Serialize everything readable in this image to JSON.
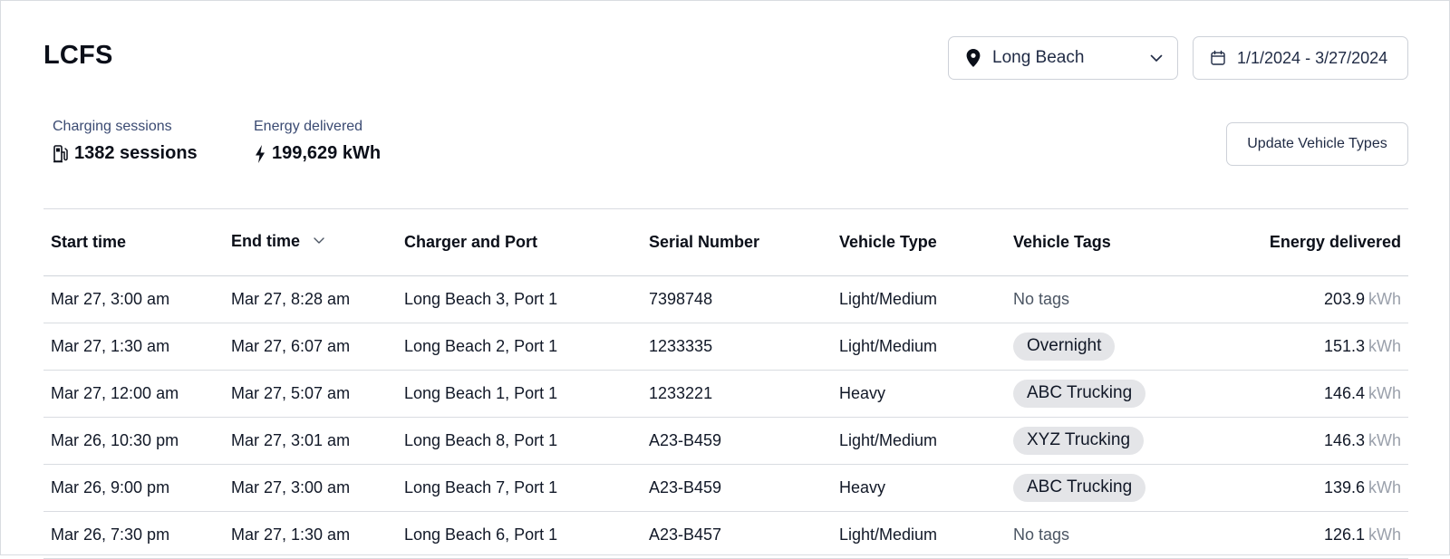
{
  "header": {
    "title": "LCFS",
    "location_value": "Long Beach",
    "date_range": "1/1/2024 - 3/27/2024"
  },
  "stats": {
    "sessions_label": "Charging sessions",
    "sessions_value": "1382 sessions",
    "energy_label": "Energy delivered",
    "energy_value": "199,629 kWh"
  },
  "actions": {
    "update_vehicle_types": "Update Vehicle Types"
  },
  "table": {
    "columns": [
      "Start time",
      "End time",
      "Charger and Port",
      "Serial Number",
      "Vehicle Type",
      "Vehicle Tags",
      "Energy delivered"
    ],
    "sort_column": "End time",
    "unit": "kWh",
    "rows": [
      {
        "start": "Mar 27, 3:00 am",
        "end": "Mar 27, 8:28 am",
        "charger": "Long Beach 3, Port 1",
        "serial": "7398748",
        "vehicle_type": "Light/Medium",
        "tag": "No tags",
        "tag_is_chip": false,
        "energy": "203.9"
      },
      {
        "start": "Mar 27, 1:30 am",
        "end": "Mar 27, 6:07 am",
        "charger": "Long Beach 2, Port 1",
        "serial": "1233335",
        "vehicle_type": "Light/Medium",
        "tag": "Overnight",
        "tag_is_chip": true,
        "energy": "151.3"
      },
      {
        "start": "Mar 27, 12:00 am",
        "end": "Mar 27, 5:07 am",
        "charger": "Long Beach 1, Port 1",
        "serial": "1233221",
        "vehicle_type": "Heavy",
        "tag": "ABC Trucking",
        "tag_is_chip": true,
        "energy": "146.4"
      },
      {
        "start": "Mar 26, 10:30 pm",
        "end": "Mar 27, 3:01 am",
        "charger": "Long Beach 8, Port 1",
        "serial": "A23-B459",
        "vehicle_type": "Light/Medium",
        "tag": "XYZ Trucking",
        "tag_is_chip": true,
        "energy": "146.3"
      },
      {
        "start": "Mar 26, 9:00 pm",
        "end": "Mar 27, 3:00 am",
        "charger": "Long Beach 7, Port 1",
        "serial": "A23-B459",
        "vehicle_type": "Heavy",
        "tag": "ABC Trucking",
        "tag_is_chip": true,
        "energy": "139.6"
      },
      {
        "start": "Mar 26, 7:30 pm",
        "end": "Mar 27, 1:30 am",
        "charger": "Long Beach 6, Port 1",
        "serial": "A23-B457",
        "vehicle_type": "Light/Medium",
        "tag": "No tags",
        "tag_is_chip": false,
        "energy": "126.1"
      }
    ]
  },
  "icons": {
    "location": "map-pin-icon",
    "dropdown": "chevron-down-icon",
    "calendar": "calendar-icon",
    "sessions": "ev-charger-icon",
    "energy": "lightning-bolt-icon",
    "sort": "sort-descending-icon"
  }
}
